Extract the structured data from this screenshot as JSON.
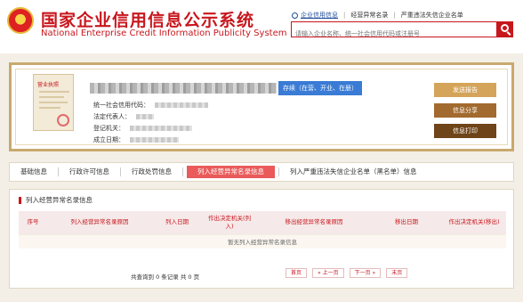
{
  "header": {
    "title": "国家企业信用信息公示系统",
    "subtitle": "National Enterprise Credit Information Publicity System",
    "links": [
      "企业信用信息",
      "经营异常名录",
      "严重违法失信企业名单"
    ],
    "search_placeholder": "请输入企业名称、统一社会信用代码或注册号"
  },
  "company": {
    "license_label": "营业执照",
    "status": "存续（在营、开业、在册）",
    "fields": [
      {
        "label": "统一社会信用代码："
      },
      {
        "label": "法定代表人："
      },
      {
        "label": "登记机关："
      },
      {
        "label": "成立日期："
      }
    ],
    "buttons": [
      "发送报告",
      "信息分享",
      "信息打印"
    ]
  },
  "tabs": [
    {
      "label": "基础信息",
      "active": false
    },
    {
      "label": "行政许可信息",
      "active": false
    },
    {
      "label": "行政处罚信息",
      "active": false
    },
    {
      "label": "列入经营异常名录信息",
      "active": true
    },
    {
      "label": "列入严重违法失信企业名单（黑名单）信息",
      "active": false
    }
  ],
  "panel": {
    "title": "列入经营异常名录信息",
    "columns": [
      "序号",
      "列入经营异常名录原因",
      "列入日期",
      "作出决定机关(列入)",
      "移出经营异常名录原因",
      "移出日期",
      "作出决定机关(移出)"
    ],
    "empty_text": "暂无列入经营异常名录信息",
    "summary": "共查询到 0 条记录 共 0 页",
    "pager": [
      "首页",
      "« 上一页",
      "下一页 »",
      "末页"
    ]
  }
}
